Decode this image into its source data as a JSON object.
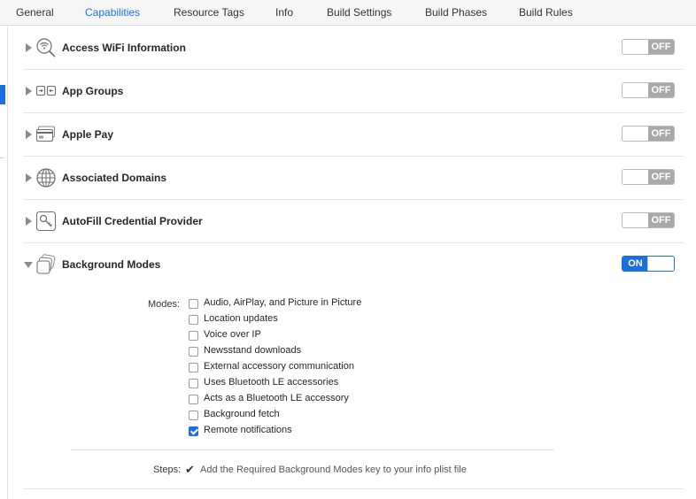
{
  "tabs": [
    {
      "label": "General",
      "active": false
    },
    {
      "label": "Capabilities",
      "active": true
    },
    {
      "label": "Resource Tags",
      "active": false
    },
    {
      "label": "Info",
      "active": false
    },
    {
      "label": "Build Settings",
      "active": false
    },
    {
      "label": "Build Phases",
      "active": false
    },
    {
      "label": "Build Rules",
      "active": false
    }
  ],
  "capabilities": [
    {
      "label": "Access WiFi Information",
      "icon": "wifi-search-icon",
      "expanded": false,
      "toggle": "OFF"
    },
    {
      "label": "App Groups",
      "icon": "app-groups-icon",
      "expanded": false,
      "toggle": "OFF"
    },
    {
      "label": "Apple Pay",
      "icon": "credit-card-icon",
      "expanded": false,
      "toggle": "OFF"
    },
    {
      "label": "Associated Domains",
      "icon": "globe-icon",
      "expanded": false,
      "toggle": "OFF"
    },
    {
      "label": "AutoFill Credential Provider",
      "icon": "key-icon",
      "expanded": false,
      "toggle": "OFF"
    },
    {
      "label": "Background Modes",
      "icon": "background-modes-icon",
      "expanded": true,
      "toggle": "ON"
    }
  ],
  "background_modes": {
    "modes_label": "Modes:",
    "items": [
      {
        "label": "Audio, AirPlay, and Picture in Picture",
        "checked": false
      },
      {
        "label": "Location updates",
        "checked": false
      },
      {
        "label": "Voice over IP",
        "checked": false
      },
      {
        "label": "Newsstand downloads",
        "checked": false
      },
      {
        "label": "External accessory communication",
        "checked": false
      },
      {
        "label": "Uses Bluetooth LE accessories",
        "checked": false
      },
      {
        "label": "Acts as a Bluetooth LE accessory",
        "checked": false
      },
      {
        "label": "Background fetch",
        "checked": false
      },
      {
        "label": "Remote notifications",
        "checked": true
      }
    ],
    "steps_label": "Steps:",
    "steps_check": "✔",
    "steps_text": "Add the Required Background Modes key to your info plist file"
  },
  "colors": {
    "accent": "#1a6fe0",
    "toggle_off": "#a9a9a9",
    "active_tab": "#1a73e8"
  }
}
